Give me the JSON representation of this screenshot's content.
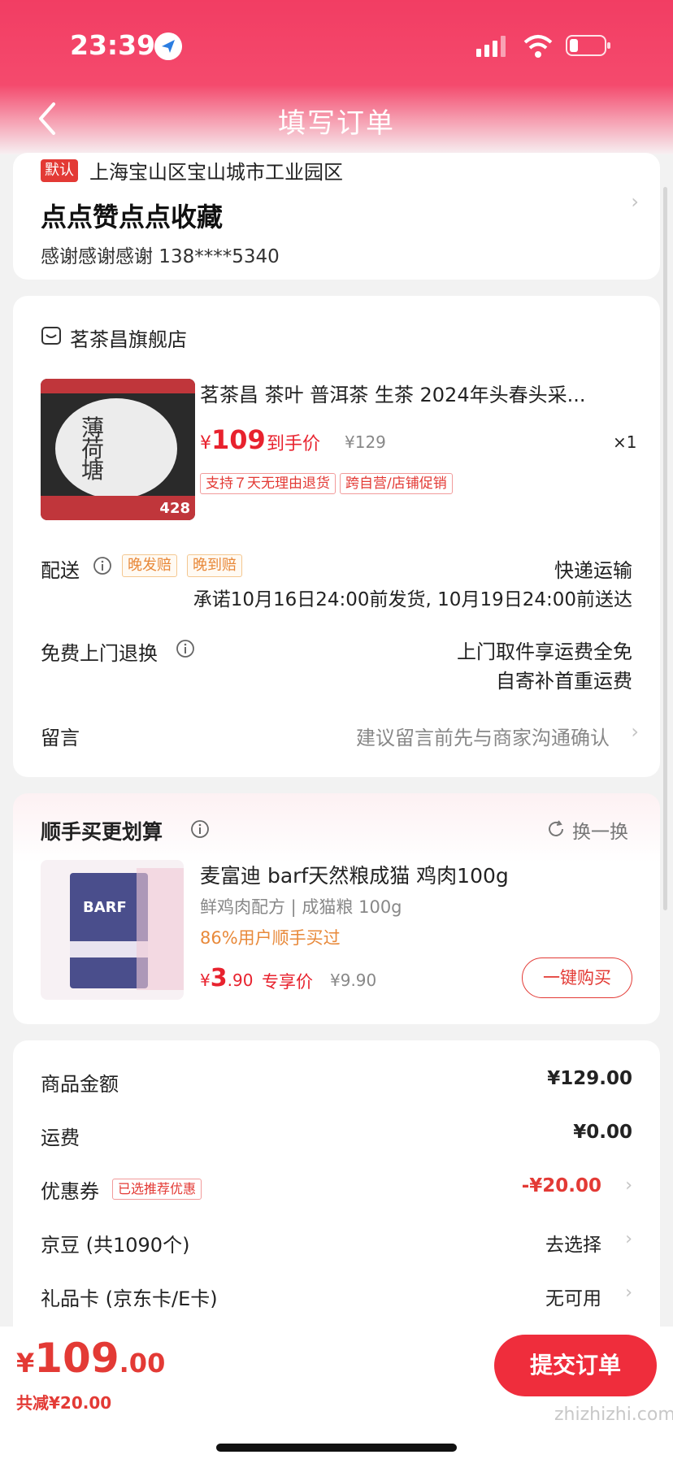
{
  "status_bar": {
    "time": "23:39"
  },
  "header": {
    "title": "填写订单"
  },
  "address": {
    "default_tag": "默认",
    "region": "上海宝山区宝山城市工业园区",
    "name": "点点赞点点收藏",
    "contact": "感谢感谢感谢  138****5340"
  },
  "order": {
    "shop_name": "茗茶昌旗舰店",
    "product": {
      "title": "茗茶昌 茶叶 普洱茶 生茶 2024年头春头采...",
      "currency": "¥",
      "price": "109",
      "price_label": "到手价",
      "original_price": "¥129",
      "quantity": "×1",
      "tags": [
        "支持７天无理由退货",
        "跨自营/店铺促销"
      ]
    },
    "delivery": {
      "label": "配送",
      "badges": [
        "晚发赔",
        "晚到赔"
      ],
      "method": "快递运输",
      "promise": "承诺10月16日24:00前发货, 10月19日24:00前送达"
    },
    "return": {
      "label": "免费上门退换",
      "line1": "上门取件享运费全免",
      "line2": "自寄补首重运费"
    },
    "message": {
      "label": "留言",
      "placeholder": "建议留言前先与商家沟通确认"
    }
  },
  "upsell": {
    "title": "顺手买更划算",
    "swap_label": "换一换",
    "item": {
      "name": "麦富迪 barf天然粮成猫 鸡肉100g",
      "spec": "鲜鸡肉配方 | 成猫粮 100g",
      "social_proof": "86%用户顺手买过",
      "currency": "¥",
      "price_int": "3",
      "price_dec": ".90",
      "price_label": "专享价",
      "original_price": "¥9.90",
      "buy_label": "一键购买",
      "image_text": "BARF"
    }
  },
  "summary": {
    "rows": [
      {
        "label": "商品金额",
        "value": "¥129.00"
      },
      {
        "label": "运费",
        "value": "¥0.00"
      },
      {
        "label": "优惠券",
        "tag": "已选推荐优惠",
        "value": "-¥20.00"
      },
      {
        "label": "京豆 (共1090个)",
        "value": "去选择"
      },
      {
        "label": "礼品卡 (京东卡/E卡)",
        "value": "无可用"
      }
    ]
  },
  "footer": {
    "currency": "¥",
    "total_int": "109",
    "total_dec": ".00",
    "saved": "共减¥20.00",
    "submit_label": "提交订单",
    "watermark": "zhizhizhi.com"
  },
  "colors": {
    "brand_red": "#e33a35",
    "header_pink": "#f23d63",
    "accent_orange": "#e8893a"
  }
}
